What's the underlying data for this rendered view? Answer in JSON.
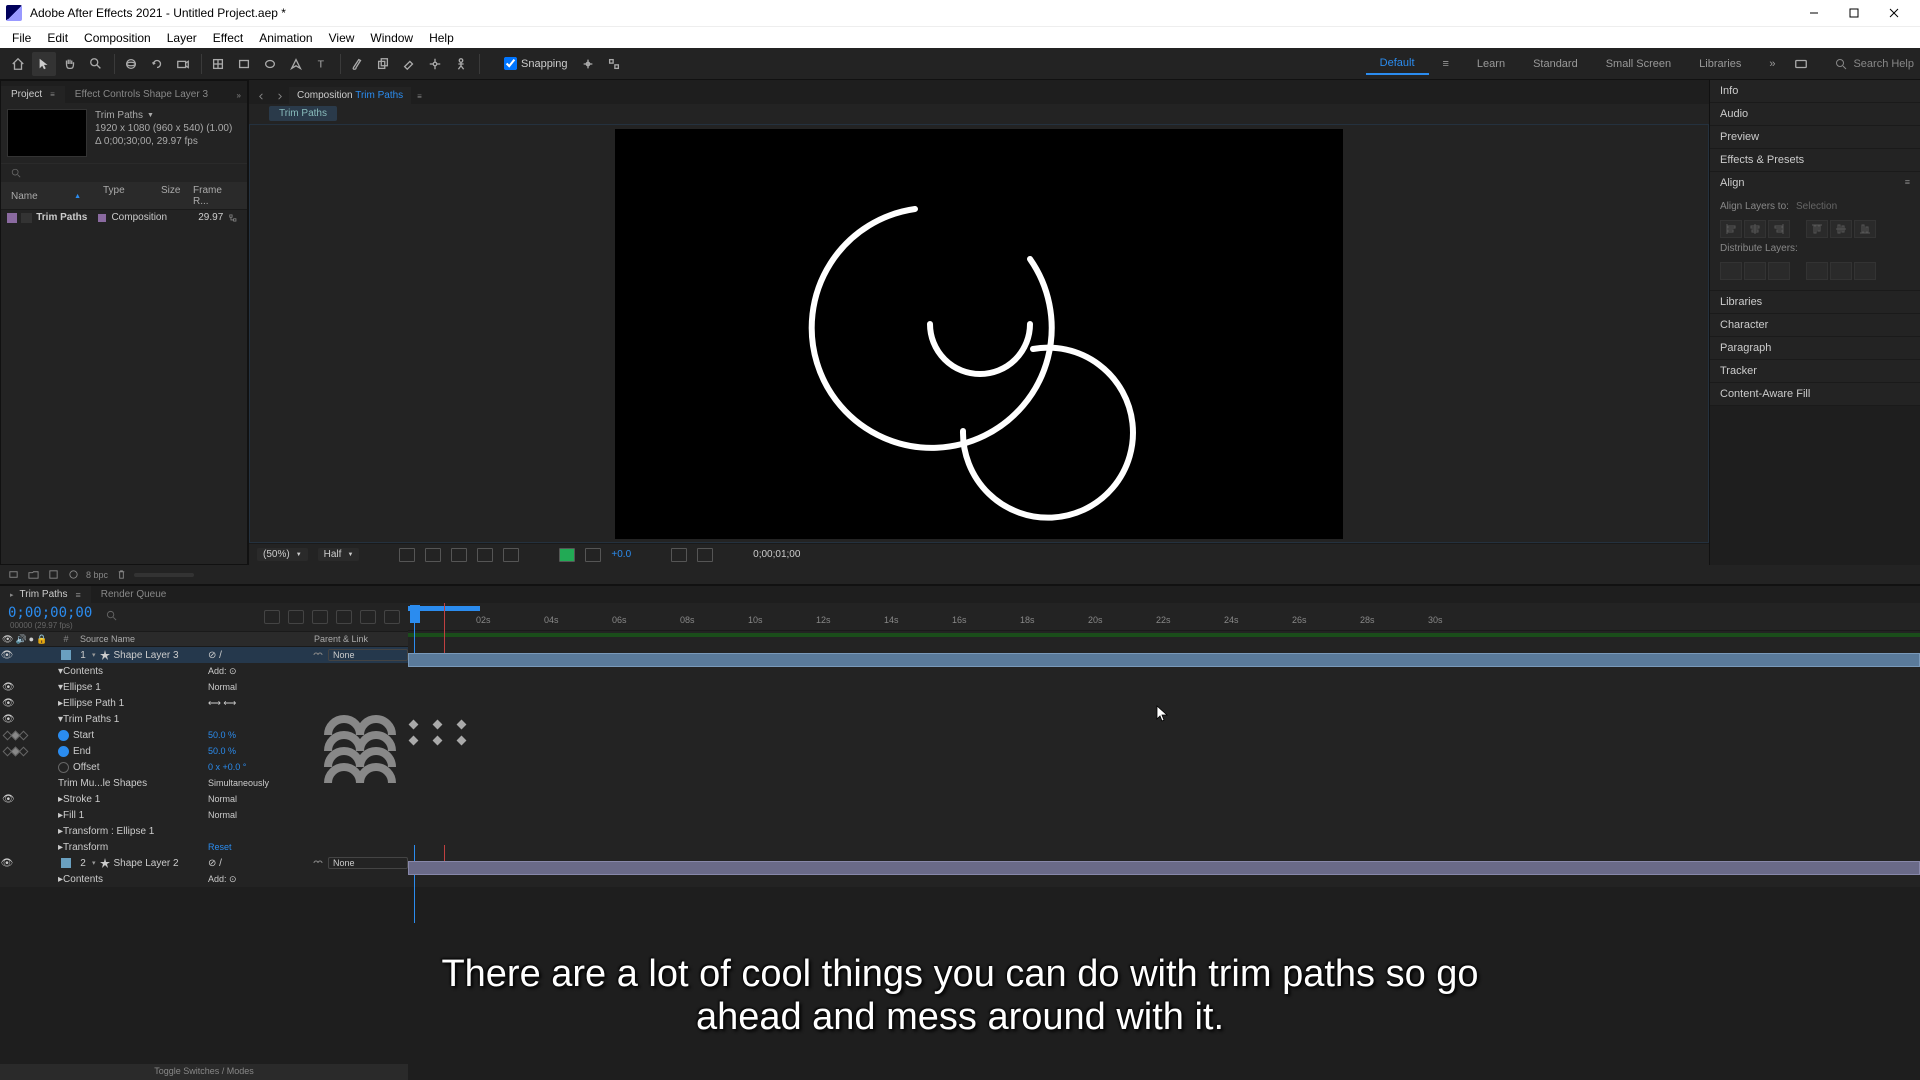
{
  "title": "Adobe After Effects 2021 - Untitled Project.aep *",
  "menu": [
    "File",
    "Edit",
    "Composition",
    "Layer",
    "Effect",
    "Animation",
    "View",
    "Window",
    "Help"
  ],
  "snapping": "Snapping",
  "workspaces": {
    "active": "Default",
    "items": [
      "Default",
      "Learn",
      "Standard",
      "Small Screen",
      "Libraries"
    ]
  },
  "search_placeholder": "Search Help",
  "projectPanel": {
    "tabs": [
      "Project",
      "Effect Controls Shape Layer 3"
    ],
    "compName": "Trim Paths",
    "compInfo1": "1920 x 1080  (960 x 540) (1.00)",
    "compInfo2": "Δ 0;00;30;00, 29.97 fps",
    "columns": {
      "name": "Name",
      "type": "Type",
      "size": "Size",
      "fr": "Frame R..."
    },
    "row": {
      "name": "Trim Paths",
      "type": "Composition",
      "fr": "29.97"
    },
    "bpc": "8 bpc"
  },
  "compPanel": {
    "label": "Composition",
    "name": "Trim Paths",
    "crumb": "Trim Paths",
    "zoom": "(50%)",
    "res": "Half",
    "exp": "+0.0",
    "time": "0;00;01;00"
  },
  "rightPanels": [
    "Info",
    "Audio",
    "Preview",
    "Effects & Presets",
    "Align",
    "Libraries",
    "Character",
    "Paragraph",
    "Tracker",
    "Content-Aware Fill"
  ],
  "align": {
    "layersTo": "Align Layers to:",
    "selDD": "Selection",
    "dist": "Distribute Layers:"
  },
  "timeline": {
    "tab": "Trim Paths",
    "renderQueue": "Render Queue",
    "timecode": "0;00;00;00",
    "timecodeSub": "00000 (29.97 fps)",
    "cols": {
      "num": "#",
      "src": "Source Name",
      "par": "Parent & Link"
    },
    "ticks": [
      "02s",
      "04s",
      "06s",
      "08s",
      "10s",
      "12s",
      "14s",
      "16s",
      "18s",
      "20s",
      "22s",
      "24s",
      "26s",
      "28s",
      "30s"
    ],
    "layers": {
      "l1": {
        "num": "1",
        "name": "Shape Layer 3",
        "mode": "None"
      },
      "l2": {
        "num": "2",
        "name": "Shape Layer 2",
        "mode": "None"
      }
    },
    "props": {
      "contents": "Contents",
      "add": "Add:",
      "ellipse1": "Ellipse 1",
      "normal": "Normal",
      "ellipsePath": "Ellipse Path 1",
      "trimPaths": "Trim Paths 1",
      "start": "Start",
      "startV": "50.0 %",
      "end": "End",
      "endV": "50.0 %",
      "offset": "Offset",
      "offsetV": "0 x +0.0 °",
      "trimMult": "Trim Mu...le Shapes",
      "simul": "Simultaneously",
      "stroke": "Stroke 1",
      "fill": "Fill 1",
      "transformE": "Transform : Ellipse 1",
      "transform": "Transform",
      "reset": "Reset"
    },
    "toggle": "Toggle Switches / Modes"
  },
  "subtitle": "There are a lot of cool things you can do with trim paths so go ahead and mess around with it."
}
